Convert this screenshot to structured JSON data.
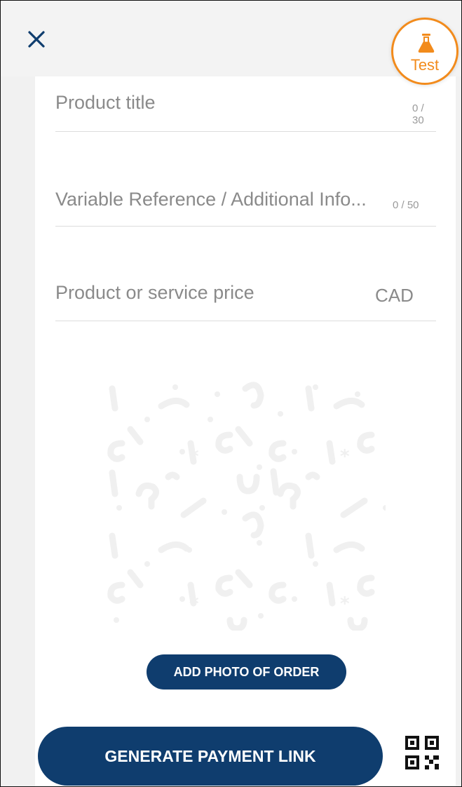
{
  "header": {
    "close_icon": "close-icon",
    "badge": {
      "label": "Test",
      "icon": "flask-icon",
      "color": "#f28b1c"
    }
  },
  "form": {
    "title_field": {
      "placeholder": "Product title",
      "counter": "0 / 30"
    },
    "reference_field": {
      "placeholder": "Variable Reference / Additional Info...",
      "counter": "0 / 50"
    },
    "price_field": {
      "placeholder": "Product or service price",
      "currency": "CAD"
    }
  },
  "photo": {
    "add_button_label": "ADD PHOTO OF ORDER"
  },
  "footer": {
    "generate_label": "GENERATE PAYMENT LINK",
    "qr_icon": "qr-code-icon"
  },
  "colors": {
    "primary": "#0f3d6e",
    "accent": "#f28b1c",
    "placeholder": "#8a8a8a",
    "background": "#f1f1f1"
  }
}
